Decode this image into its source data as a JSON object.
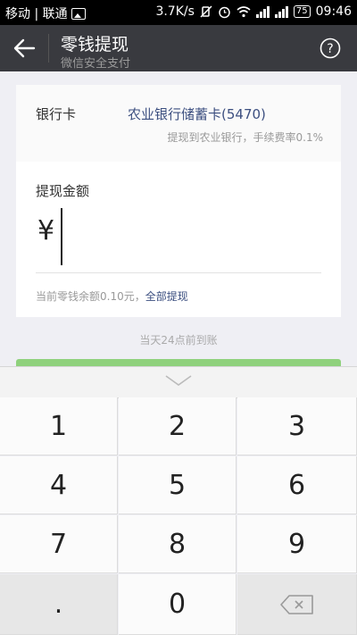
{
  "status_bar": {
    "carrier": "移动 | 联通",
    "speed": "3.7K/s",
    "battery": "75",
    "time": "09:46"
  },
  "title_bar": {
    "title": "零钱提现",
    "subtitle": "微信安全支付",
    "back_icon": "back-arrow-icon",
    "help_icon": "help-icon"
  },
  "bank": {
    "label": "银行卡",
    "card_name": "农业银行储蓄卡(5470)",
    "note": "提现到农业银行，手续费率0.1%"
  },
  "amount": {
    "label": "提现金额",
    "currency": "¥",
    "value": "",
    "balance_text": "当前零钱余额0.10元，",
    "withdraw_all": "全部提现"
  },
  "arrival_note": "当天24点前到账",
  "keypad": {
    "keys": [
      "1",
      "2",
      "3",
      "4",
      "5",
      "6",
      "7",
      "8",
      "9",
      ".",
      "0"
    ]
  },
  "colors": {
    "title_bg": "#393a3f",
    "link": "#3c4f80",
    "green": "#8fd17c"
  }
}
